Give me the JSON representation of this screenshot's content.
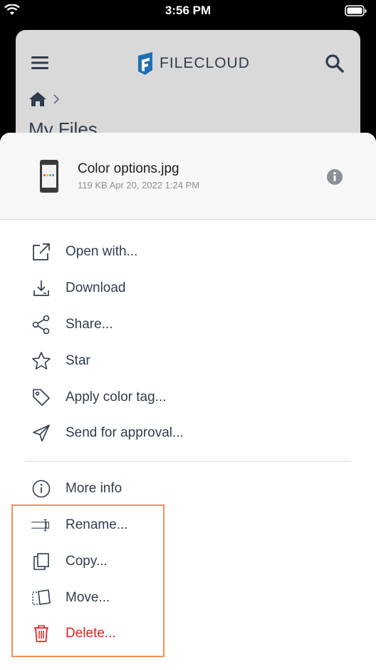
{
  "status_bar": {
    "time": "3:56 PM"
  },
  "background": {
    "logo_text": "FILECLOUD",
    "title": "My Files"
  },
  "file": {
    "name": "Color options.jpg",
    "meta": "119 KB Apr 20, 2022 1:24 PM"
  },
  "menu": {
    "open_with": "Open with...",
    "download": "Download",
    "share": "Share...",
    "star": "Star",
    "apply_color_tag": "Apply color tag...",
    "send_for_approval": "Send for approval...",
    "more_info": "More info",
    "rename": "Rename...",
    "copy": "Copy...",
    "move": "Move...",
    "delete": "Delete..."
  },
  "colors": {
    "text": "#2f3d4f",
    "danger": "#e02020",
    "highlight": "#f0915a",
    "brand": "#1e6fb5"
  },
  "icons": [
    "wifi-icon",
    "battery-icon",
    "hamburger-menu-icon",
    "filecloud-logo",
    "search-icon",
    "home-icon",
    "chevron-right-icon",
    "info-icon",
    "external-link-icon",
    "download-icon",
    "share-icon",
    "star-icon",
    "tag-icon",
    "send-icon",
    "info-circle-icon",
    "rename-icon",
    "copy-icon",
    "move-icon",
    "trash-icon"
  ]
}
